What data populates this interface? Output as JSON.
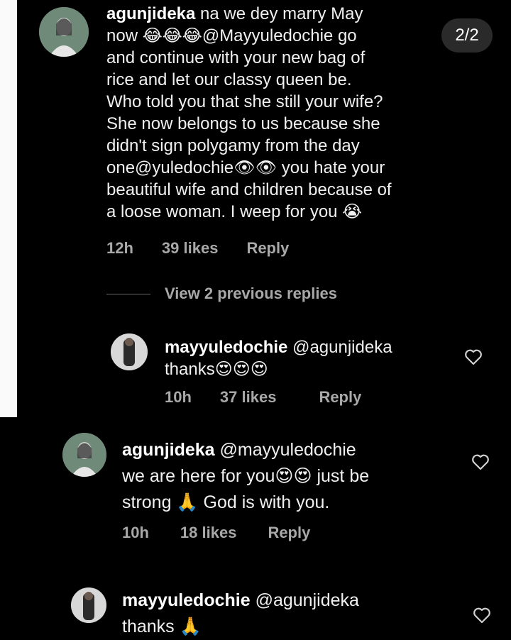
{
  "page_indicator": "2/2",
  "comments": [
    {
      "username": "agunjideka",
      "lines": [
        "na we dey marry May",
        "now 😂😂😂@Mayyuledochie go",
        "and continue with your new bag of",
        "rice and let our classy queen be.",
        "Who told you that she still your wife?",
        "She now belongs to us because she",
        "didn't sign polygamy from the day",
        "one@yuledochie👁👁 you hate your",
        "beautiful wife and children because of",
        "a loose woman. I weep for you 😭"
      ],
      "time": "12h",
      "likes": "39 likes",
      "reply": "Reply"
    },
    {
      "username": "mayyuledochie",
      "mention": "@agunjideka",
      "body": "thanks😍😍😍",
      "time": "10h",
      "likes": "37 likes",
      "reply": "Reply"
    },
    {
      "username": "agunjideka",
      "mention": "@mayyuledochie",
      "lines": [
        "we are here for you😍😍 just be",
        "strong 🙏 God is with you."
      ],
      "time": "10h",
      "likes": "18 likes",
      "reply": "Reply"
    },
    {
      "username": "mayyuledochie",
      "mention": "@agunjideka",
      "body": "thanks 🙏"
    }
  ],
  "view_previous_replies": "View 2 previous replies",
  "icons": {
    "heart": "heart-outline-icon",
    "avatar": "user-avatar"
  },
  "colors": {
    "background": "#000000",
    "text": "#f0f0f0",
    "meta": "#a8a8a8",
    "badge": "#2a2a2a"
  }
}
